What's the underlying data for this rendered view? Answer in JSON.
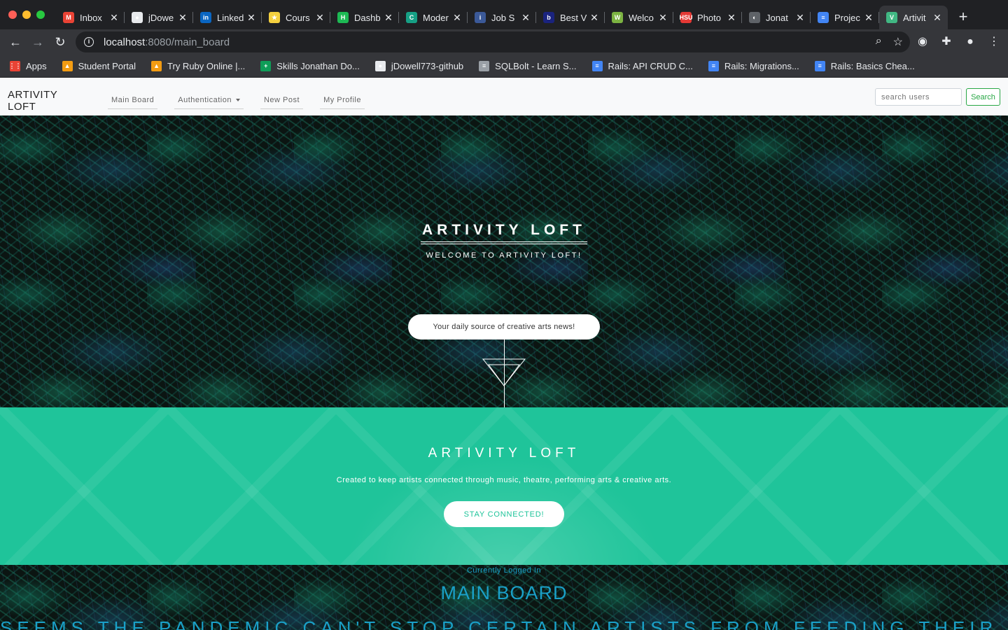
{
  "browser": {
    "tabs": [
      {
        "title": "Inbox",
        "icon": "gmail-icon",
        "color": "#ea4335",
        "glyph": "M"
      },
      {
        "title": "jDowe",
        "icon": "github-icon",
        "color": "#e8eaed",
        "glyph": "●"
      },
      {
        "title": "Linked",
        "icon": "linkedin-icon",
        "color": "#0a66c2",
        "glyph": "in"
      },
      {
        "title": "Cours",
        "icon": "course-icon",
        "color": "#f4d03f",
        "glyph": "★"
      },
      {
        "title": "Dashb",
        "icon": "dashboard-icon",
        "color": "#1db954",
        "glyph": "H"
      },
      {
        "title": "Moder",
        "icon": "codesignal-icon",
        "color": "#16a085",
        "glyph": "C"
      },
      {
        "title": "Job S",
        "icon": "jobsearch-icon",
        "color": "#3b5998",
        "glyph": "i"
      },
      {
        "title": "Best V",
        "icon": "best-icon",
        "color": "#1a237e",
        "glyph": "b"
      },
      {
        "title": "Welco",
        "icon": "welcome-icon",
        "color": "#7cb342",
        "glyph": "W"
      },
      {
        "title": "Photo",
        "icon": "photo-icon",
        "color": "#e53935",
        "glyph": "HSU"
      },
      {
        "title": "Jonat",
        "icon": "globe-icon",
        "color": "#5f6368",
        "glyph": "◐"
      },
      {
        "title": "Projec",
        "icon": "docs-icon",
        "color": "#4285f4",
        "glyph": "≡"
      },
      {
        "title": "Artivit",
        "icon": "vue-icon",
        "color": "#41b883",
        "glyph": "V"
      }
    ],
    "url_host": "localhost",
    "url_path": ":8080/main_board",
    "bookmarks": [
      {
        "label": "Apps",
        "icon": "apps-grid-icon",
        "color": "#ea4335",
        "glyph": "⋮⋮"
      },
      {
        "label": "Student Portal",
        "icon": "student-portal-icon",
        "color": "#f39c12",
        "glyph": "▲"
      },
      {
        "label": "Try Ruby Online |...",
        "icon": "try-ruby-icon",
        "color": "#f39c12",
        "glyph": "▲"
      },
      {
        "label": "Skills Jonathan Do...",
        "icon": "skills-icon",
        "color": "#0f9d58",
        "glyph": "+"
      },
      {
        "label": "jDowell773-github",
        "icon": "github-icon",
        "color": "#e8eaed",
        "glyph": "●"
      },
      {
        "label": "SQLBolt - Learn S...",
        "icon": "sqlbolt-icon",
        "color": "#9aa0a6",
        "glyph": "≡"
      },
      {
        "label": "Rails: API CRUD C...",
        "icon": "docs-icon",
        "color": "#4285f4",
        "glyph": "≡"
      },
      {
        "label": "Rails: Migrations...",
        "icon": "docs-icon",
        "color": "#4285f4",
        "glyph": "≡"
      },
      {
        "label": "Rails: Basics Chea...",
        "icon": "docs-icon",
        "color": "#4285f4",
        "glyph": "≡"
      }
    ]
  },
  "site": {
    "brand": "ARTIVITY LOFT",
    "nav": {
      "main_board": "Main Board",
      "authentication": "Authentication",
      "new_post": "New Post",
      "my_profile": "My Profile"
    },
    "search": {
      "placeholder": "search users",
      "button": "Search"
    }
  },
  "hero": {
    "title": "ARTIVITY LOFT",
    "subtitle": "WELCOME TO ARTIVITY LOFT!",
    "pill": "Your daily source of creative arts news!"
  },
  "band": {
    "title": "ARTIVITY LOFT",
    "text": "Created to keep artists connected through music, theatre, performing arts & creative arts.",
    "button": "STAY CONNECTED!",
    "color": "#1fc49a"
  },
  "board": {
    "status": "Currently Logged In",
    "title": "MAIN BOARD",
    "headline": "SEEMS THE PANDEMIC CAN'T STOP CERTAIN ARTISTS FROM FEEDING THEIR FANS CONTENT",
    "color": "#1aa0c8"
  }
}
